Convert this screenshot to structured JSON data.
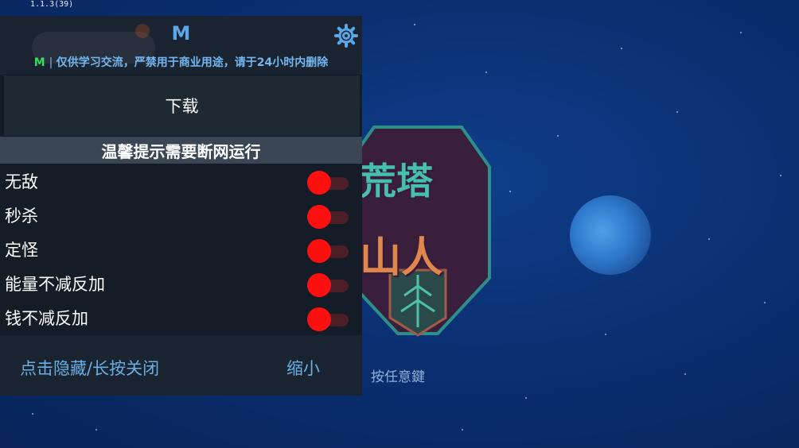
{
  "app": {
    "version": "1.1.3(39)",
    "logo_line1": "荒塔",
    "logo_line2": "山人",
    "press_any_key": "按任意鍵"
  },
  "menu": {
    "title": "M",
    "notice_prefix": "M",
    "notice_text": "仅供学习交流，严禁用于商业用途，请于24小时内删除",
    "download_label": "下载",
    "tip": "温馨提示需要断网运行",
    "options": [
      {
        "label": "无敌",
        "enabled": false
      },
      {
        "label": "秒杀",
        "enabled": false
      },
      {
        "label": "定怪",
        "enabled": false
      },
      {
        "label": "能量不减反加",
        "enabled": false
      },
      {
        "label": "钱不减反加",
        "enabled": false
      }
    ],
    "hide_label": "点击隐藏/长按关闭",
    "shrink_label": "缩小"
  },
  "colors": {
    "accent": "#5aa8e8",
    "toggle_knob": "#ff1010",
    "toggle_track": "#4b1f25",
    "notice_prefix": "#32e05a",
    "panel_bg": "#131c27"
  },
  "icons": {
    "settings": "gear-icon"
  }
}
